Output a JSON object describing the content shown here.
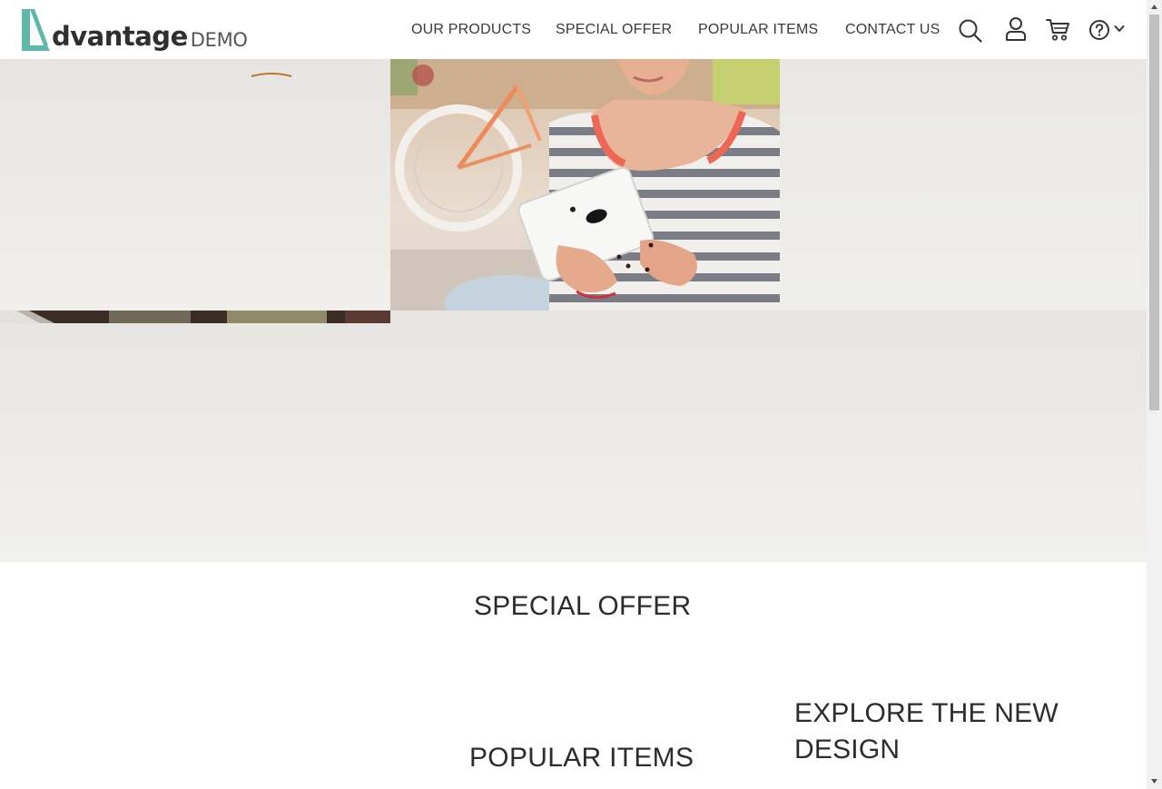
{
  "logo": {
    "word": "dvantage",
    "suffix": "DEMO"
  },
  "nav": [
    "OUR PRODUCTS",
    "SPECIAL OFFER",
    "POPULAR ITEMS",
    "CONTACT US"
  ],
  "icons": [
    "search-icon",
    "user-icon",
    "cart-icon",
    "help-icon",
    "chevron-down-icon"
  ],
  "sections": {
    "special_offer": "SPECIAL OFFER",
    "popular_items": "POPULAR ITEMS",
    "explore": "EXPLORE THE NEW DESIGN"
  },
  "colors": {
    "brand": "#5fb7a9",
    "text": "#2b2b2b",
    "hero_bg": "#ebe9e5"
  }
}
